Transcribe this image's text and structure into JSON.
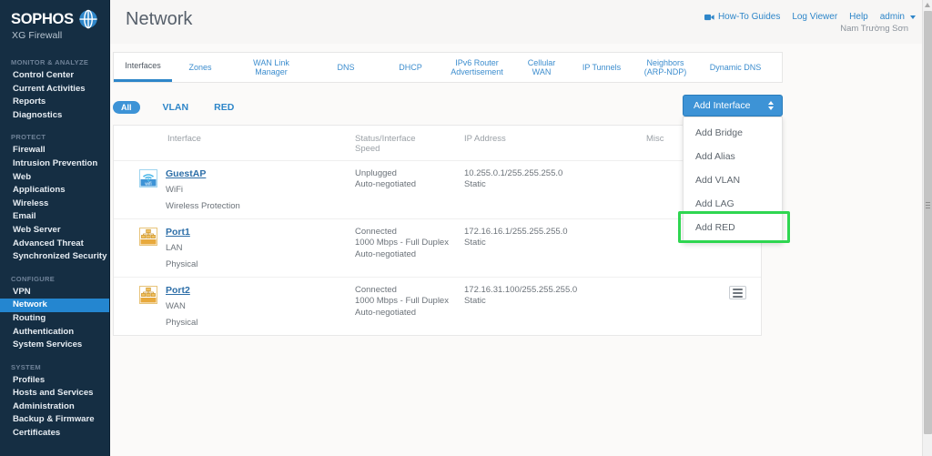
{
  "brand": {
    "name": "SOPHOS",
    "product": "XG Firewall",
    "logo_icon": "globe-icon"
  },
  "sidebar": {
    "groups": [
      {
        "title": "MONITOR & ANALYZE",
        "items": [
          {
            "label": "Control Center",
            "active": false
          },
          {
            "label": "Current Activities",
            "active": false
          },
          {
            "label": "Reports",
            "active": false
          },
          {
            "label": "Diagnostics",
            "active": false
          }
        ]
      },
      {
        "title": "PROTECT",
        "items": [
          {
            "label": "Firewall",
            "active": false
          },
          {
            "label": "Intrusion Prevention",
            "active": false
          },
          {
            "label": "Web",
            "active": false
          },
          {
            "label": "Applications",
            "active": false
          },
          {
            "label": "Wireless",
            "active": false
          },
          {
            "label": "Email",
            "active": false
          },
          {
            "label": "Web Server",
            "active": false
          },
          {
            "label": "Advanced Threat",
            "active": false
          },
          {
            "label": "Synchronized Security",
            "active": false
          }
        ]
      },
      {
        "title": "CONFIGURE",
        "items": [
          {
            "label": "VPN",
            "active": false
          },
          {
            "label": "Network",
            "active": true
          },
          {
            "label": "Routing",
            "active": false
          },
          {
            "label": "Authentication",
            "active": false
          },
          {
            "label": "System Services",
            "active": false
          }
        ]
      },
      {
        "title": "SYSTEM",
        "items": [
          {
            "label": "Profiles",
            "active": false
          },
          {
            "label": "Hosts and Services",
            "active": false
          },
          {
            "label": "Administration",
            "active": false
          },
          {
            "label": "Backup & Firmware",
            "active": false
          },
          {
            "label": "Certificates",
            "active": false
          }
        ]
      }
    ]
  },
  "header": {
    "title": "Network",
    "links": [
      {
        "label": "How-To Guides",
        "icon": "video-icon"
      },
      {
        "label": "Log Viewer",
        "icon": ""
      },
      {
        "label": "Help",
        "icon": ""
      }
    ],
    "account": {
      "label": "admin",
      "caret_icon": "chevron-down-icon",
      "display_name": "Nam Trường Sơn"
    }
  },
  "tabs": [
    {
      "label": "Interfaces",
      "active": true
    },
    {
      "label": "Zones",
      "active": false
    },
    {
      "label": "WAN Link Manager",
      "active": false
    },
    {
      "label": "DNS",
      "active": false
    },
    {
      "label": "DHCP",
      "active": false
    },
    {
      "label": "IPv6 Router Advertisement",
      "active": false
    },
    {
      "label": "Cellular WAN",
      "active": false
    },
    {
      "label": "IP Tunnels",
      "active": false
    },
    {
      "label": "Neighbors (ARP-NDP)",
      "active": false
    },
    {
      "label": "Dynamic DNS",
      "active": false
    }
  ],
  "filters": [
    {
      "label": "All",
      "selected": true
    },
    {
      "label": "VLAN",
      "selected": false
    },
    {
      "label": "RED",
      "selected": false
    }
  ],
  "add_interface": {
    "label": "Add Interface",
    "spinner_icon": "updown-arrows-icon",
    "menu": [
      {
        "label": "Add Bridge",
        "highlighted": false
      },
      {
        "label": "Add Alias",
        "highlighted": false
      },
      {
        "label": "Add VLAN",
        "highlighted": false
      },
      {
        "label": "Add LAG",
        "highlighted": false
      },
      {
        "label": "Add RED",
        "highlighted": true
      }
    ],
    "highlight_color": "#2fd651"
  },
  "table": {
    "columns": [
      "Interface",
      "Status/Interface Speed",
      "IP Address",
      "Misc"
    ],
    "column_headers": {
      "interface": "Interface",
      "status_line1": "Status/Interface",
      "status_line2": "Speed",
      "ip": "IP Address",
      "misc": "Misc"
    },
    "rows": [
      {
        "icon": "wifi-interface-icon",
        "name": "GuestAP",
        "type": "WiFi",
        "kind": "Wireless Protection",
        "status": "Unplugged",
        "speed": "",
        "negotiation": "Auto-negotiated",
        "ip": "10.255.0.1/255.255.255.0",
        "ip_mode": "Static",
        "has_menu": false
      },
      {
        "icon": "ethernet-interface-icon",
        "name": "Port1",
        "type": "LAN",
        "kind": "Physical",
        "status": "Connected",
        "speed": "1000 Mbps - Full Duplex",
        "negotiation": "Auto-negotiated",
        "ip": "172.16.16.1/255.255.255.0",
        "ip_mode": "Static",
        "has_menu": false
      },
      {
        "icon": "ethernet-interface-icon",
        "name": "Port2",
        "type": "WAN",
        "kind": "Physical",
        "status": "Connected",
        "speed": "1000 Mbps - Full Duplex",
        "negotiation": "Auto-negotiated",
        "ip": "172.16.31.100/255.255.255.0",
        "ip_mode": "Static",
        "has_menu": true
      }
    ]
  },
  "colors": {
    "sidebar_bg": "#152e43",
    "accent": "#2e86c9",
    "active_nav": "#2486d0",
    "highlight": "#2fd651"
  }
}
